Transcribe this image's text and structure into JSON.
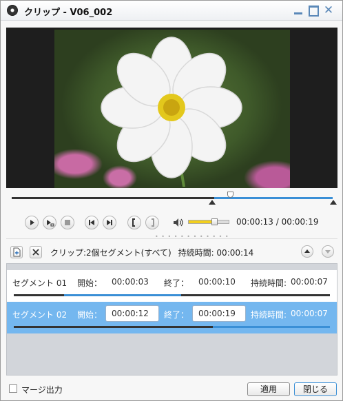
{
  "window": {
    "title": "クリップ - V06_002"
  },
  "player": {
    "position_fraction": 0.68,
    "selection_start_fraction": 0.63,
    "volume_fraction": 0.65,
    "timecode": "00:00:13 / 00:00:19"
  },
  "clip": {
    "info": "クリップ:2個セグメント(すべて)",
    "duration_text": "持続時間: 00:00:14"
  },
  "segments": [
    {
      "name": "セグメント 01",
      "start_label": "開始：",
      "start": "00:00:03",
      "end_label": "終了：",
      "end": "00:00:10",
      "duration_label": "持続時間:",
      "duration": "00:00:07",
      "bar_start_fraction": 0.16,
      "bar_end_fraction": 0.53
    },
    {
      "name": "セグメント 02",
      "start_label": "開始：",
      "start": "00:00:12",
      "end_label": "終了：",
      "end": "00:00:19",
      "duration_label": "持続時間:",
      "duration": "00:00:07",
      "bar_start_fraction": 0.63,
      "bar_end_fraction": 1.0
    }
  ],
  "footer": {
    "merge_label": "マージ出力",
    "apply_label": "適用",
    "close_label": "閉じる"
  },
  "colors": {
    "accent": "#3a8fd6",
    "selected_row": "#74b7ef",
    "volume": "#f2cf1d"
  }
}
